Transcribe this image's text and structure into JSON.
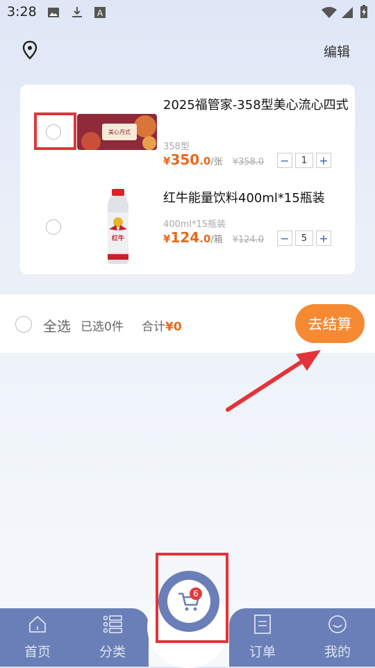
{
  "status_bar": {
    "time": "3:28",
    "left_icons": [
      "image-icon",
      "download-icon",
      "text-a-icon"
    ],
    "right_icons": [
      "wifi-icon",
      "signal-icon",
      "battery-charging-icon"
    ]
  },
  "header": {
    "location_icon": "map-pin-icon",
    "edit_label": "编辑"
  },
  "cart_items": [
    {
      "title": "2025福管家-358型美心流心四式",
      "spec": "358型",
      "price_currency": "¥",
      "price_int": "350",
      "price_dec": ".0",
      "unit": "/张",
      "original_price": "¥358.0",
      "quantity": "1",
      "selected": false,
      "image_text": "美心月式"
    },
    {
      "title": " 红牛能量饮料400ml*15瓶装",
      "spec": "400ml*15瓶装",
      "price_currency": "¥",
      "price_int": "124",
      "price_dec": ".0",
      "unit": "/箱",
      "original_price": "¥124.0",
      "quantity": "5",
      "selected": false,
      "image_text": "红牛"
    }
  ],
  "summary": {
    "select_all_label": "全选",
    "selected_count_label": "已选0件",
    "total_label": "合计",
    "total_currency": "¥",
    "total_amount": "0",
    "checkout_label": "去结算"
  },
  "tab_bar": {
    "tabs": [
      {
        "label": "首页",
        "icon": "home-icon"
      },
      {
        "label": "分类",
        "icon": "category-list-icon"
      },
      {
        "label": "订单",
        "icon": "order-doc-icon"
      },
      {
        "label": "我的",
        "icon": "smiley-profile-icon"
      }
    ],
    "cart_badge": "6",
    "cart_icon": "cart-icon"
  },
  "colors": {
    "accent_orange": "#f58a32",
    "price_orange": "#e8691d",
    "tab_blue": "#6a7fb7",
    "highlight_red": "#e2343a"
  }
}
